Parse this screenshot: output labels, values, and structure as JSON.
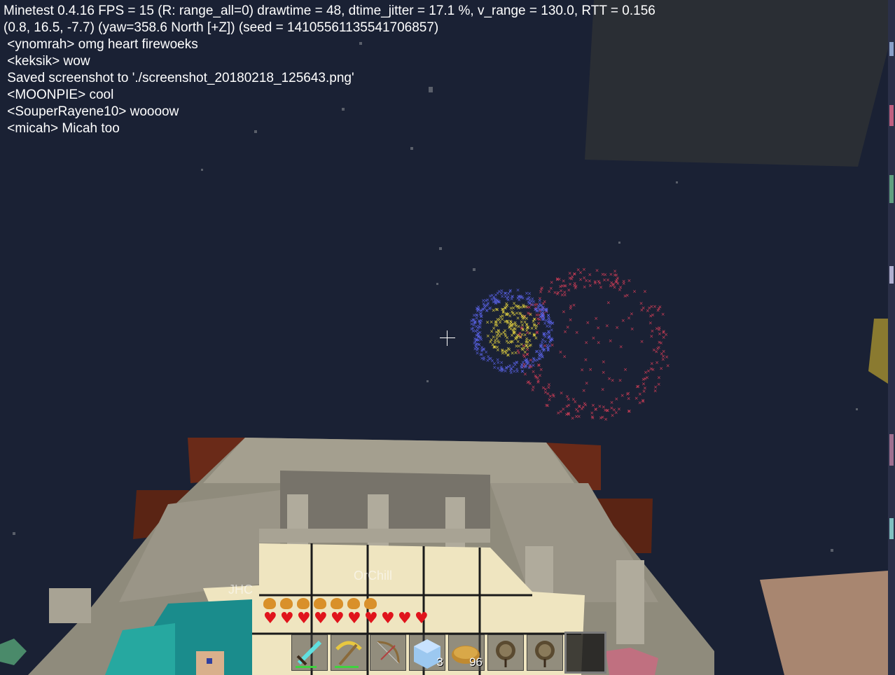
{
  "hud": {
    "debug_line_1": "Minetest 0.4.16 FPS = 15 (R: range_all=0) drawtime = 48, dtime_jitter = 17.1 %, v_range = 130.0, RTT = 0.156",
    "debug_line_2": "(0.8, 16.5, -7.7) (yaw=358.6 North [+Z]) (seed = 14105561135541706857)"
  },
  "chat": [
    " <ynomrah> omg heart firewoeks",
    " <keksik> wow",
    " Saved screenshot to './screenshot_20180218_125643.png'",
    " <MOONPIE> cool",
    " <SouperRayene10> woooow",
    " <micah> Micah too"
  ],
  "nametags": {
    "left": "JHC",
    "center": "OrChill"
  },
  "status": {
    "hunger_icons": 7,
    "hearts": 10,
    "health_color": "#e0141c",
    "hunger_color": "#d9902a"
  },
  "hotbar": {
    "selected_index": 7,
    "slots": [
      {
        "item": "diamond-sword-icon",
        "count": ""
      },
      {
        "item": "gold-pickaxe-icon",
        "count": ""
      },
      {
        "item": "bow-icon",
        "count": ""
      },
      {
        "item": "ice-block-icon",
        "count": "3"
      },
      {
        "item": "bread-icon",
        "count": "96"
      },
      {
        "item": "firework-rocket-icon",
        "count": ""
      },
      {
        "item": "firework-rocket-icon",
        "count": ""
      },
      {
        "item": "empty-slot",
        "count": ""
      }
    ]
  },
  "colors": {
    "sky": "#1a2134",
    "firework_blue": "#5a63e8",
    "firework_yellow": "#e8d640",
    "firework_red": "#e0405a",
    "wood": "#a49f8f"
  }
}
